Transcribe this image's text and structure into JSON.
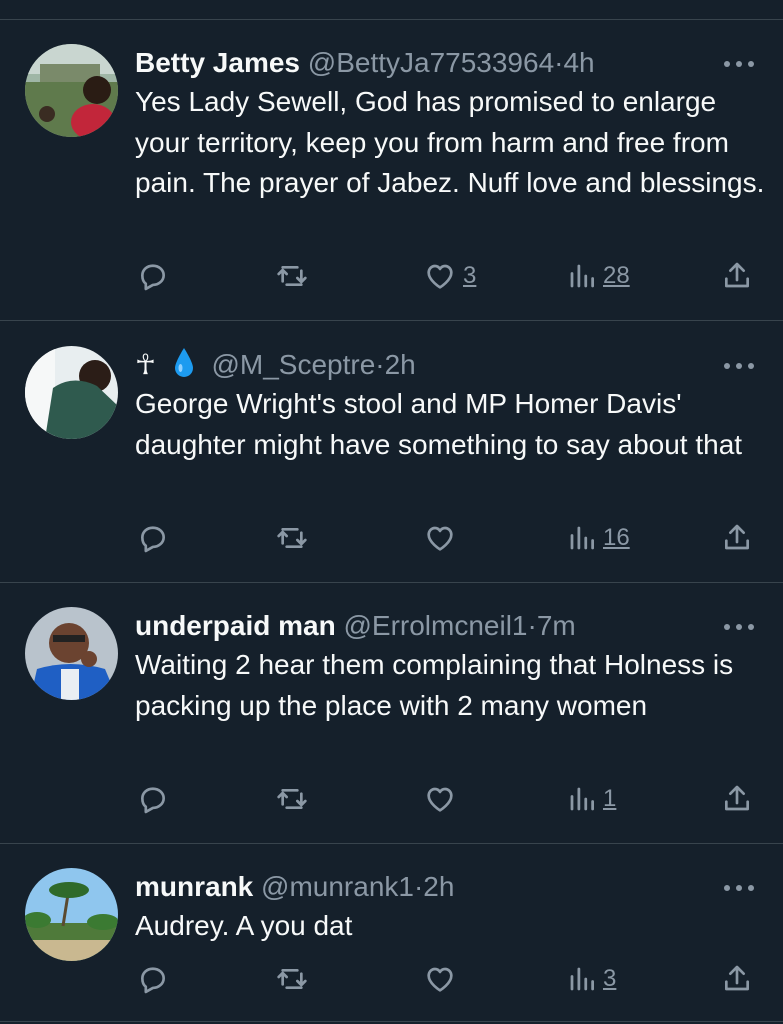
{
  "tweets": [
    {
      "name": "Betty James",
      "handle": "@BettyJa77533964",
      "time": "4h",
      "text": "Yes Lady Sewell, God has promised to enlarge your territory, keep you from harm and free from pain. The prayer of Jabez. Nuff love and blessings.",
      "likes": "3",
      "views": "28"
    },
    {
      "name": "",
      "name_glyph": "☥",
      "handle": "@M_Sceptre",
      "time": "2h",
      "text": "George Wright's stool and MP  Homer Davis' daughter might have something to say about that",
      "likes": "",
      "views": "16"
    },
    {
      "name": "underpaid man",
      "handle": "@Errolmcneil1",
      "time": "7m",
      "text": "Waiting 2 hear them complaining that Holness is packing up the place with 2 many women",
      "likes": "",
      "views": "1"
    },
    {
      "name": "munrank",
      "handle": "@munrank1",
      "time": "2h",
      "text": "Audrey. A you dat",
      "likes": "",
      "views": "3"
    }
  ],
  "separator": "·",
  "icons": {
    "reply": "reply-icon",
    "retweet": "retweet-icon",
    "like": "heart-icon",
    "views": "views-icon",
    "share": "share-icon",
    "more": "more-icon"
  },
  "colors": {
    "background": "#15202b",
    "text": "#f7f9f9",
    "secondary": "#8b98a5",
    "divider": "#38444d",
    "droplet": "#1d9bf0"
  }
}
